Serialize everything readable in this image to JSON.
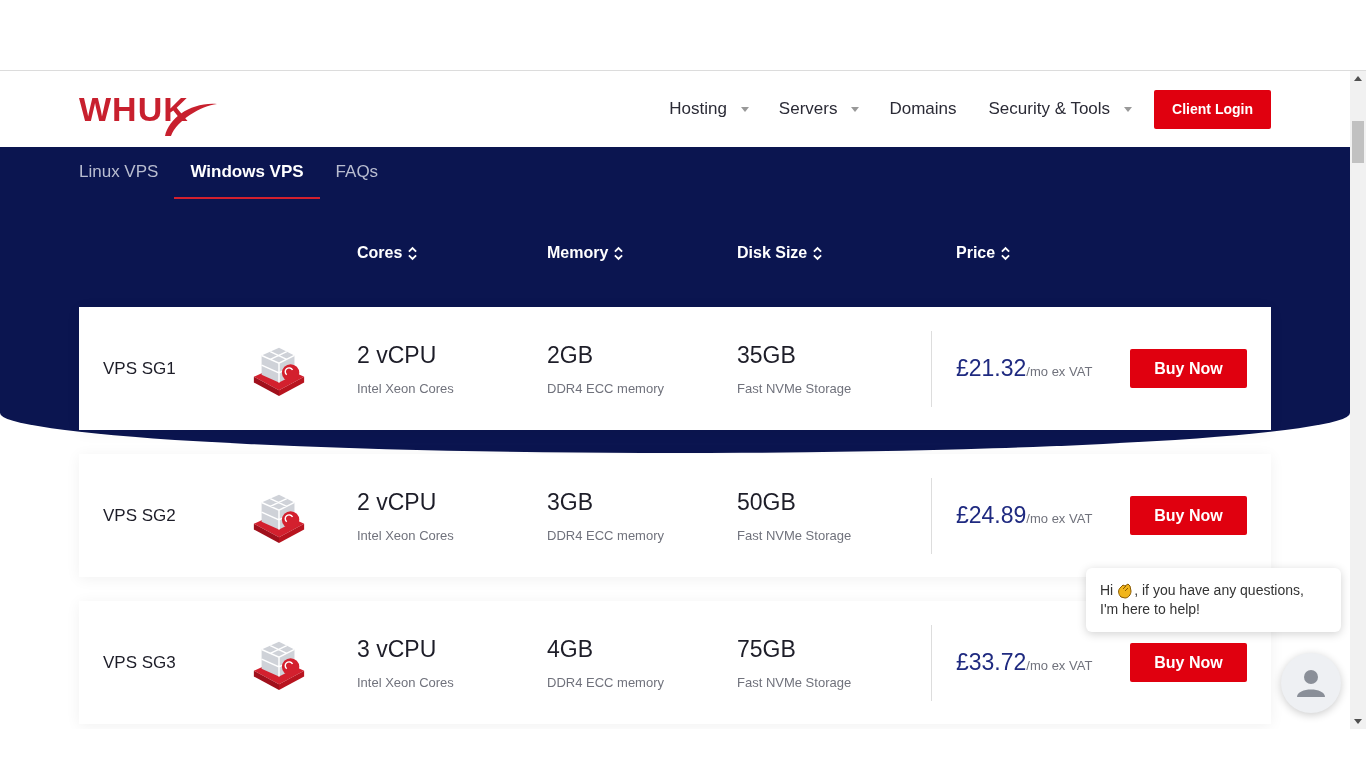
{
  "header": {
    "logo": "WHUK",
    "nav": [
      {
        "label": "Hosting",
        "dropdown": true
      },
      {
        "label": "Servers",
        "dropdown": true
      },
      {
        "label": "Domains",
        "dropdown": false
      },
      {
        "label": "Security & Tools",
        "dropdown": true
      }
    ],
    "login": "Client Login"
  },
  "tabs": [
    {
      "label": "Linux VPS",
      "selected": false
    },
    {
      "label": "Windows VPS",
      "selected": true
    },
    {
      "label": "FAQs",
      "selected": false
    }
  ],
  "columns": [
    {
      "label": "Cores"
    },
    {
      "label": "Memory"
    },
    {
      "label": "Disk Size"
    },
    {
      "label": "Price"
    }
  ],
  "plans": [
    {
      "name": "VPS SG1",
      "cores": "2 vCPU",
      "cores_note": "Intel Xeon Cores",
      "memory": "2GB",
      "memory_note": "DDR4 ECC memory",
      "disk": "35GB",
      "disk_note": "Fast NVMe Storage",
      "price": "£21.32",
      "price_note": "/mo ex VAT",
      "button": "Buy Now"
    },
    {
      "name": "VPS SG2",
      "cores": "2 vCPU",
      "cores_note": "Intel Xeon Cores",
      "memory": "3GB",
      "memory_note": "DDR4 ECC memory",
      "disk": "50GB",
      "disk_note": "Fast NVMe Storage",
      "price": "£24.89",
      "price_note": "/mo ex VAT",
      "button": "Buy Now"
    },
    {
      "name": "VPS SG3",
      "cores": "3 vCPU",
      "cores_note": "Intel Xeon Cores",
      "memory": "4GB",
      "memory_note": "DDR4 ECC memory",
      "disk": "75GB",
      "disk_note": "Fast NVMe Storage",
      "price": "£33.72",
      "price_note": "/mo ex VAT",
      "button": "Buy Now"
    }
  ],
  "chat": {
    "greeting": "Hi",
    "message": [
      ", if you have any questions,",
      "I'm here to help!"
    ]
  }
}
